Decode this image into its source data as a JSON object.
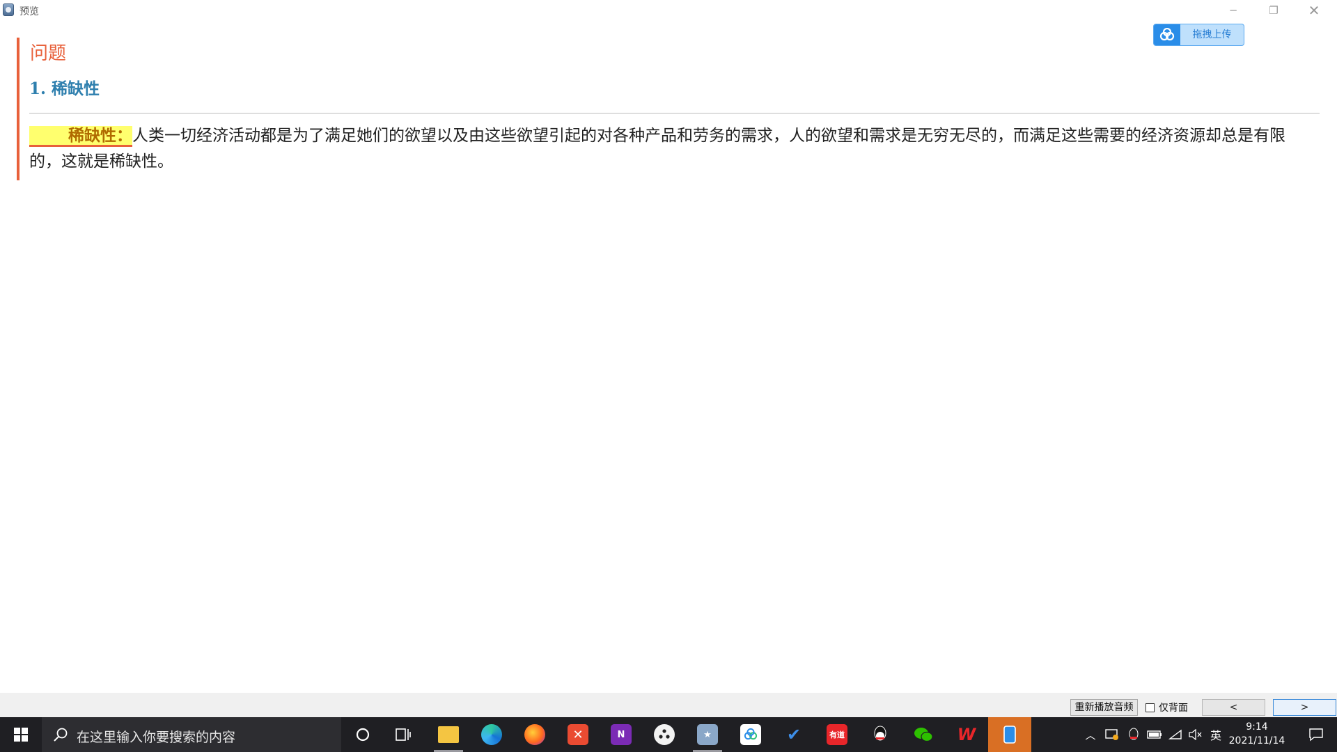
{
  "window": {
    "title": "预览",
    "minimize": "─",
    "restore": "❐",
    "close": "✕"
  },
  "upload": {
    "label": "拖拽上传"
  },
  "card": {
    "question_label": "问题",
    "heading": "1. 稀缺性",
    "term": "稀缺性：",
    "definition": "人类一切经济活动都是为了满足她们的欲望以及由这些欲望引起的对各种产品和劳务的需求，人的欲望和需求是无穷无尽的，而满足这些需要的经济资源却总是有限的，这就是稀缺性。"
  },
  "controls": {
    "replay_label": "重新播放音频",
    "back_only_label": "仅背面",
    "back_only_checked": false,
    "prev_label": "<",
    "next_label": ">"
  },
  "taskbar": {
    "search_placeholder": "在这里输入你要搜索的内容",
    "apps": [
      {
        "name": "cortana-icon"
      },
      {
        "name": "task-view-icon"
      },
      {
        "name": "file-explorer-icon"
      },
      {
        "name": "edge-icon"
      },
      {
        "name": "firefox-icon"
      },
      {
        "name": "xmind-icon"
      },
      {
        "name": "onenote-icon",
        "glyph": "N"
      },
      {
        "name": "davinci-icon"
      },
      {
        "name": "anki-icon"
      },
      {
        "name": "baidu-netdisk-icon"
      },
      {
        "name": "todo-icon"
      },
      {
        "name": "youdao-icon",
        "glyph": "有道"
      },
      {
        "name": "qq-icon"
      },
      {
        "name": "wechat-icon"
      },
      {
        "name": "wps-icon",
        "glyph": "W"
      },
      {
        "name": "phone-link-icon"
      }
    ],
    "tray": {
      "ime": "英",
      "time": "9:14",
      "date": "2021/11/14"
    }
  },
  "colors": {
    "accent": "#e8603a",
    "heading": "#2e7fae",
    "highlight": "#ffff6e",
    "taskbar": "#1f1f23",
    "active_app": "#d96f24"
  }
}
